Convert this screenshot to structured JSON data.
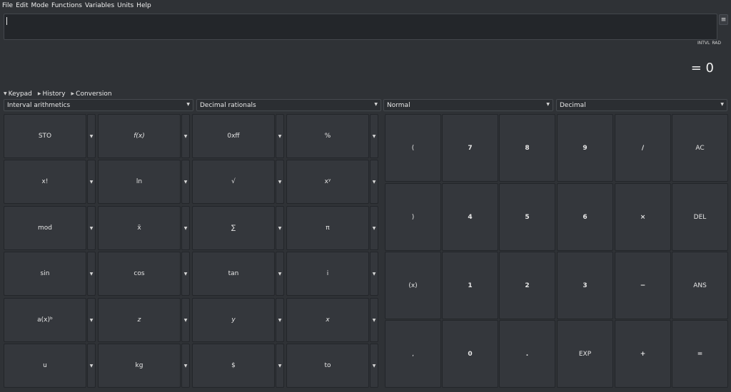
{
  "menubar": [
    "File",
    "Edit",
    "Mode",
    "Functions",
    "Variables",
    "Units",
    "Help"
  ],
  "menu_button_label": "≡",
  "status": [
    "INTVL",
    "RAD"
  ],
  "result": "= 0",
  "tabs": [
    "Keypad",
    "History",
    "Conversion"
  ],
  "selects": [
    "Interval arithmetics",
    "Decimal rationals",
    "Normal",
    "Decimal"
  ],
  "function_rows": [
    [
      "STO",
      "f(x)",
      "0xff",
      "%"
    ],
    [
      "x!",
      "ln",
      "√",
      "xʸ"
    ],
    [
      "mod",
      "x̄",
      "∑",
      "π"
    ],
    [
      "sin",
      "cos",
      "tan",
      "i"
    ],
    [
      "a(x)ᵇ",
      "z",
      "y",
      "x"
    ],
    [
      "u",
      "kg",
      "$",
      "to"
    ]
  ],
  "keypad_rows": [
    [
      "(",
      "7",
      "8",
      "9",
      "/",
      "AC"
    ],
    [
      ")",
      "4",
      "5",
      "6",
      "×",
      "DEL"
    ],
    [
      "(x)",
      "1",
      "2",
      "3",
      "−",
      "ANS"
    ],
    [
      ",",
      "0",
      ".",
      "EXP",
      "+",
      "="
    ]
  ]
}
